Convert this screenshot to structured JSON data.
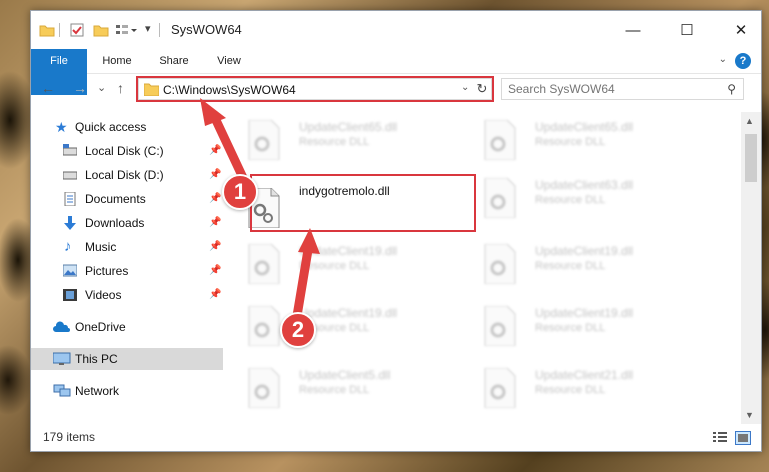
{
  "window": {
    "title": "SysWOW64",
    "controls": {
      "minimize": "—",
      "maximize": "☐",
      "close": "✕"
    }
  },
  "ribbon": {
    "tabs": [
      {
        "label": "File"
      },
      {
        "label": "Home"
      },
      {
        "label": "Share"
      },
      {
        "label": "View"
      }
    ],
    "help": "?"
  },
  "nav": {
    "back": "←",
    "forward": "→",
    "recent": "⌄",
    "up": "↑",
    "address": "C:\\Windows\\SysWOW64",
    "search_placeholder": "Search SysWOW64"
  },
  "sidebar": {
    "items": [
      {
        "label": "Quick access",
        "icon": "star-icon"
      },
      {
        "label": "Local Disk (C:)",
        "icon": "drive-icon",
        "pinned": true
      },
      {
        "label": "Local Disk (D:)",
        "icon": "drive-icon",
        "pinned": true
      },
      {
        "label": "Documents",
        "icon": "documents-icon",
        "pinned": true
      },
      {
        "label": "Downloads",
        "icon": "download-icon",
        "pinned": true
      },
      {
        "label": "Music",
        "icon": "music-icon",
        "pinned": true
      },
      {
        "label": "Pictures",
        "icon": "pictures-icon",
        "pinned": true
      },
      {
        "label": "Videos",
        "icon": "videos-icon",
        "pinned": true
      },
      {
        "label": "OneDrive",
        "icon": "cloud-icon"
      },
      {
        "label": "This PC",
        "icon": "computer-icon",
        "selected": true
      },
      {
        "label": "Network",
        "icon": "network-icon"
      }
    ]
  },
  "files": {
    "highlighted": {
      "name": "indygotremolo.dll",
      "type": ""
    },
    "others": [
      {
        "name": "UpdateClient65.dll",
        "type": "Resource DLL"
      },
      {
        "name": "UpdateClient65.dll",
        "type": "Resource DLL"
      },
      {
        "name": "UpdateClient63.dll",
        "type": "Resource DLL"
      },
      {
        "name": "UpdateClient19.dll",
        "type": "Resource DLL"
      },
      {
        "name": "UpdateClient19.dll",
        "type": "Resource DLL"
      },
      {
        "name": "UpdateClient19.dll",
        "type": "Resource DLL"
      },
      {
        "name": "UpdateClient19.dll",
        "type": "Resource DLL"
      },
      {
        "name": "UpdateClient5.dll",
        "type": "Resource DLL"
      },
      {
        "name": "UpdateClient21.dll",
        "type": "Resource DLL"
      }
    ]
  },
  "status": {
    "item_count": "179 items"
  },
  "callouts": {
    "one": "1",
    "two": "2"
  },
  "colors": {
    "accent": "#1979ca",
    "highlight": "#d9363e",
    "callout": "#e0403e"
  }
}
